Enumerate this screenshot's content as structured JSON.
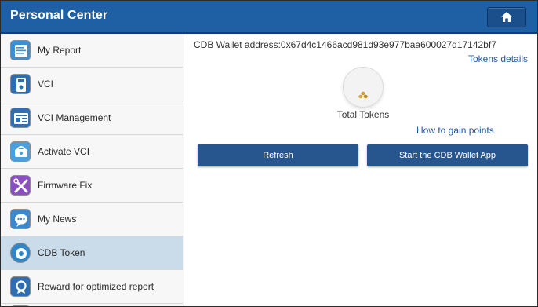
{
  "header": {
    "title": "Personal Center",
    "home_icon": "home-icon"
  },
  "sidebar": {
    "items": [
      {
        "label": "My Report",
        "icon": "report-icon"
      },
      {
        "label": "VCI",
        "icon": "vci-icon"
      },
      {
        "label": "VCI Management",
        "icon": "vci-management-icon"
      },
      {
        "label": "Activate VCI",
        "icon": "activate-vci-icon"
      },
      {
        "label": "Firmware Fix",
        "icon": "firmware-fix-icon"
      },
      {
        "label": "My News",
        "icon": "news-icon"
      },
      {
        "label": "CDB Token",
        "icon": "cdb-token-icon",
        "selected": true
      },
      {
        "label": "Reward for optimized report",
        "icon": "reward-icon"
      }
    ]
  },
  "main": {
    "wallet_address": "CDB Wallet address:0x67d4c1466acd981d93e977baa600027d17142bf7",
    "tokens_details": "Tokens details",
    "total_tokens_label": "Total Tokens",
    "how_to_gain": "How to gain points",
    "refresh_label": "Refresh",
    "start_wallet_label": "Start the CDB Wallet App"
  },
  "colors": {
    "header_bg": "#1f5fa3",
    "button_bg": "#27558d",
    "link": "#1f5aa6",
    "selected_item_bg": "#cadcea"
  }
}
